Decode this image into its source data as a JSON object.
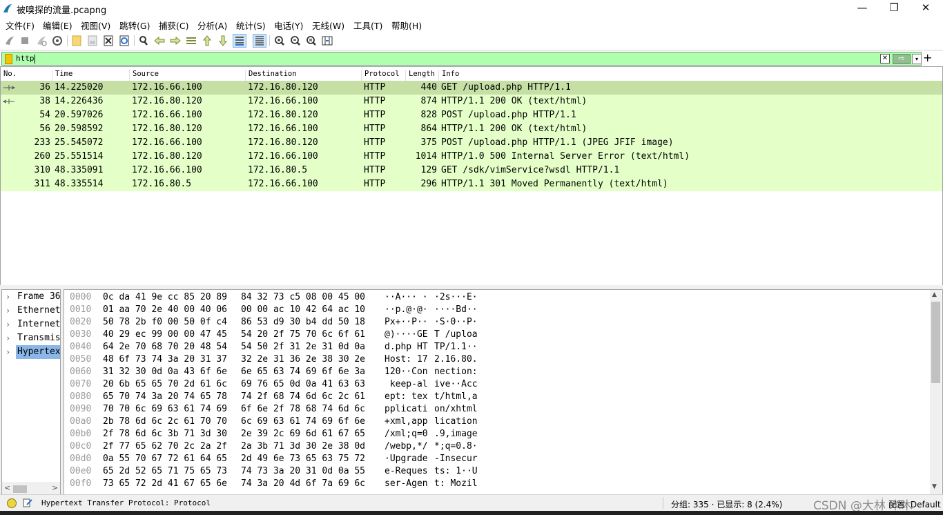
{
  "window": {
    "title": "被嗅探的流量.pcapng",
    "minimize": "—",
    "maximize": "❐",
    "close": "✕"
  },
  "menu": [
    "文件(F)",
    "编辑(E)",
    "视图(V)",
    "跳转(G)",
    "捕获(C)",
    "分析(A)",
    "统计(S)",
    "电话(Y)",
    "无线(W)",
    "工具(T)",
    "帮助(H)"
  ],
  "toolbar_icons": [
    "start-capture-icon",
    "stop-capture-icon",
    "restart-capture-icon",
    "capture-options-icon",
    "open-file-icon",
    "save-file-icon",
    "close-file-icon",
    "reload-file-icon",
    "find-packet-icon",
    "go-back-icon",
    "go-forward-icon",
    "go-to-packet-icon",
    "go-first-icon",
    "go-last-icon",
    "autoscroll-icon",
    "colorize-icon",
    "zoom-in-icon",
    "zoom-out-icon",
    "zoom-normal-icon",
    "resize-columns-icon"
  ],
  "filter": {
    "value": "http",
    "clear": "✕",
    "apply": "⇨",
    "dropdown": "▾",
    "add": "+"
  },
  "packet_list": {
    "headers": {
      "no": "No.",
      "time": "Time",
      "source": "Source",
      "destination": "Destination",
      "protocol": "Protocol",
      "length": "Length",
      "info": "Info"
    },
    "rows": [
      {
        "no": "36",
        "time": "14.225020",
        "source": "172.16.66.100",
        "destination": "172.16.80.120",
        "protocol": "HTTP",
        "length": "440",
        "info": "GET /upload.php HTTP/1.1"
      },
      {
        "no": "38",
        "time": "14.226436",
        "source": "172.16.80.120",
        "destination": "172.16.66.100",
        "protocol": "HTTP",
        "length": "874",
        "info": "HTTP/1.1 200 OK  (text/html)"
      },
      {
        "no": "54",
        "time": "20.597026",
        "source": "172.16.66.100",
        "destination": "172.16.80.120",
        "protocol": "HTTP",
        "length": "828",
        "info": "POST /upload.php HTTP/1.1"
      },
      {
        "no": "56",
        "time": "20.598592",
        "source": "172.16.80.120",
        "destination": "172.16.66.100",
        "protocol": "HTTP",
        "length": "864",
        "info": "HTTP/1.1 200 OK  (text/html)"
      },
      {
        "no": "233",
        "time": "25.545072",
        "source": "172.16.66.100",
        "destination": "172.16.80.120",
        "protocol": "HTTP",
        "length": "375",
        "info": "POST /upload.php HTTP/1.1  (JPEG JFIF image)"
      },
      {
        "no": "260",
        "time": "25.551514",
        "source": "172.16.80.120",
        "destination": "172.16.66.100",
        "protocol": "HTTP",
        "length": "1014",
        "info": "HTTP/1.0 500 Internal Server Error  (text/html)"
      },
      {
        "no": "310",
        "time": "48.335091",
        "source": "172.16.66.100",
        "destination": "172.16.80.5",
        "protocol": "HTTP",
        "length": "129",
        "info": "GET /sdk/vimService?wsdl HTTP/1.1"
      },
      {
        "no": "311",
        "time": "48.335514",
        "source": "172.16.80.5",
        "destination": "172.16.66.100",
        "protocol": "HTTP",
        "length": "296",
        "info": "HTTP/1.1 301 Moved Permanently  (text/html)"
      }
    ]
  },
  "details_tree": [
    {
      "label": "Frame 36",
      "arrow": "›",
      "selected": false
    },
    {
      "label": "Ethernet",
      "arrow": "›",
      "selected": false
    },
    {
      "label": "Internet",
      "arrow": "›",
      "selected": false
    },
    {
      "label": "Transmis",
      "arrow": "›",
      "selected": false
    },
    {
      "label": "Hypertex",
      "arrow": "›",
      "selected": true
    }
  ],
  "tree_scroll": {
    "left": "<",
    "right": ">"
  },
  "hex_dump": [
    {
      "offset": "0000",
      "bytes1": "0c da 41 9e cc 85 20 89",
      "bytes2": "84 32 73 c5 08 00 45 00",
      "ascii1": "··A··· ·",
      "ascii2": "·2s···E·"
    },
    {
      "offset": "0010",
      "bytes1": "01 aa 70 2e 40 00 40 06",
      "bytes2": "00 00 ac 10 42 64 ac 10",
      "ascii1": "··p.@·@·",
      "ascii2": "····Bd··"
    },
    {
      "offset": "0020",
      "bytes1": "50 78 2b f0 00 50 0f c4",
      "bytes2": "86 53 d9 30 b4 dd 50 18",
      "ascii1": "Px+··P··",
      "ascii2": "·S·0··P·"
    },
    {
      "offset": "0030",
      "bytes1": "40 29 ec 99 00 00 47 45",
      "bytes2": "54 20 2f 75 70 6c 6f 61",
      "ascii1": "@)····GE",
      "ascii2": "T /uploa"
    },
    {
      "offset": "0040",
      "bytes1": "64 2e 70 68 70 20 48 54",
      "bytes2": "54 50 2f 31 2e 31 0d 0a",
      "ascii1": "d.php HT",
      "ascii2": "TP/1.1··"
    },
    {
      "offset": "0050",
      "bytes1": "48 6f 73 74 3a 20 31 37",
      "bytes2": "32 2e 31 36 2e 38 30 2e",
      "ascii1": "Host: 17",
      "ascii2": "2.16.80."
    },
    {
      "offset": "0060",
      "bytes1": "31 32 30 0d 0a 43 6f 6e",
      "bytes2": "6e 65 63 74 69 6f 6e 3a",
      "ascii1": "120··Con",
      "ascii2": "nection:"
    },
    {
      "offset": "0070",
      "bytes1": "20 6b 65 65 70 2d 61 6c",
      "bytes2": "69 76 65 0d 0a 41 63 63",
      "ascii1": " keep-al",
      "ascii2": "ive··Acc"
    },
    {
      "offset": "0080",
      "bytes1": "65 70 74 3a 20 74 65 78",
      "bytes2": "74 2f 68 74 6d 6c 2c 61",
      "ascii1": "ept: tex",
      "ascii2": "t/html,a"
    },
    {
      "offset": "0090",
      "bytes1": "70 70 6c 69 63 61 74 69",
      "bytes2": "6f 6e 2f 78 68 74 6d 6c",
      "ascii1": "pplicati",
      "ascii2": "on/xhtml"
    },
    {
      "offset": "00a0",
      "bytes1": "2b 78 6d 6c 2c 61 70 70",
      "bytes2": "6c 69 63 61 74 69 6f 6e",
      "ascii1": "+xml,app",
      "ascii2": "lication"
    },
    {
      "offset": "00b0",
      "bytes1": "2f 78 6d 6c 3b 71 3d 30",
      "bytes2": "2e 39 2c 69 6d 61 67 65",
      "ascii1": "/xml;q=0",
      "ascii2": ".9,image"
    },
    {
      "offset": "00c0",
      "bytes1": "2f 77 65 62 70 2c 2a 2f",
      "bytes2": "2a 3b 71 3d 30 2e 38 0d",
      "ascii1": "/webp,*/",
      "ascii2": "*;q=0.8·"
    },
    {
      "offset": "00d0",
      "bytes1": "0a 55 70 67 72 61 64 65",
      "bytes2": "2d 49 6e 73 65 63 75 72",
      "ascii1": "·Upgrade",
      "ascii2": "-Insecur"
    },
    {
      "offset": "00e0",
      "bytes1": "65 2d 52 65 71 75 65 73",
      "bytes2": "74 73 3a 20 31 0d 0a 55",
      "ascii1": "e-Reques",
      "ascii2": "ts: 1··U"
    },
    {
      "offset": "00f0",
      "bytes1": "73 65 72 2d 41 67 65 6e",
      "bytes2": "74 3a 20 4d 6f 7a 69 6c",
      "ascii1": "ser-Agen",
      "ascii2": "t: Mozil"
    }
  ],
  "statusbar": {
    "field_text": "Hypertext Transfer Protocol: Protocol",
    "packets": "分组: 335 · 已显示: 8 (2.4%)",
    "profile": "配置: Default",
    "watermark": "CSDN @大林  木木"
  },
  "colors": {
    "http_row_bg": "#e4ffc7",
    "selected_row_bg": "#c5dfa5",
    "filter_valid_bg": "#afffaf",
    "tree_selected_bg": "#8ab6e8"
  }
}
